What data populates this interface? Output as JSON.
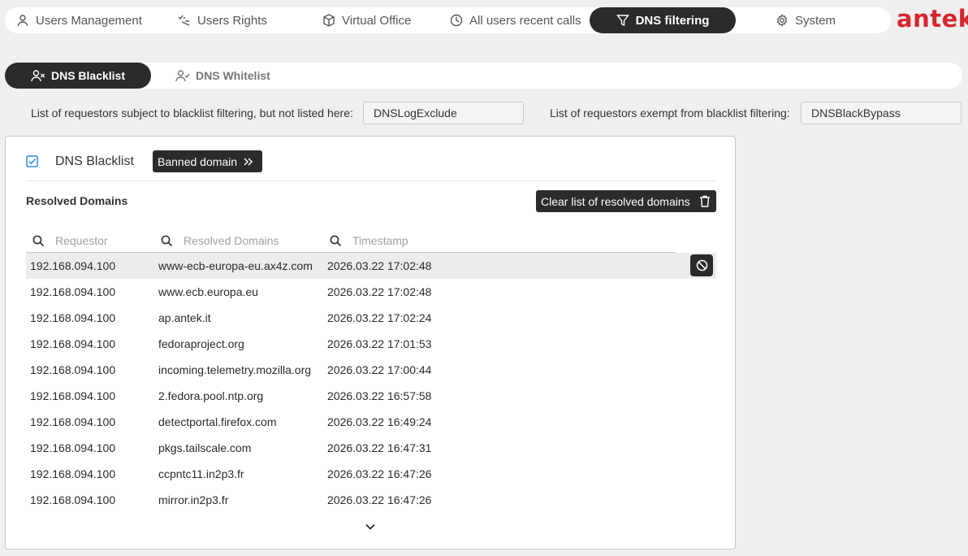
{
  "nav": {
    "tabs": [
      {
        "label": "Users Management",
        "icon": "user-icon"
      },
      {
        "label": "Users Rights",
        "icon": "check-list-icon"
      },
      {
        "label": "Virtual Office",
        "icon": "cube-icon"
      },
      {
        "label": "All users recent calls",
        "icon": "clock-icon"
      },
      {
        "label": "DNS filtering",
        "icon": "filter-icon",
        "active": true
      },
      {
        "label": "System",
        "icon": "gear-icon"
      }
    ],
    "logo": "antek"
  },
  "subnav": {
    "tabs": [
      {
        "label": "DNS Blacklist",
        "icon": "user-x-icon",
        "active": true
      },
      {
        "label": "DNS Whitelist",
        "icon": "user-check-icon"
      }
    ]
  },
  "requestors": {
    "blacklist_label": "List of requestors subject to blacklist filtering, but not listed here:",
    "blacklist_value": "DNSLogExclude",
    "bypass_label": "List of requestors exempt from blacklist filtering:",
    "bypass_value": "DNSBlackBypass"
  },
  "panel": {
    "title": "DNS Blacklist",
    "banned_button": "Banned domain",
    "section_title": "Resolved Domains",
    "clear_button": "Clear list of resolved domains",
    "columns": {
      "requestor": "Requestor",
      "domains": "Resolved Domains",
      "timestamp": "Timestamp"
    },
    "rows": [
      {
        "requestor": "192.168.094.100",
        "domain": "www-ecb-europa-eu.ax4z.com",
        "timestamp": "2026.03.22 17:02:48"
      },
      {
        "requestor": "192.168.094.100",
        "domain": "www.ecb.europa.eu",
        "timestamp": "2026.03.22 17:02:48"
      },
      {
        "requestor": "192.168.094.100",
        "domain": "ap.antek.it",
        "timestamp": "2026.03.22 17:02:24"
      },
      {
        "requestor": "192.168.094.100",
        "domain": "fedoraproject.org",
        "timestamp": "2026.03.22 17:01:53"
      },
      {
        "requestor": "192.168.094.100",
        "domain": "incoming.telemetry.mozilla.org",
        "timestamp": "2026.03.22 17:00:44"
      },
      {
        "requestor": "192.168.094.100",
        "domain": "2.fedora.pool.ntp.org",
        "timestamp": "2026.03.22 16:57:58"
      },
      {
        "requestor": "192.168.094.100",
        "domain": "detectportal.firefox.com",
        "timestamp": "2026.03.22 16:49:24"
      },
      {
        "requestor": "192.168.094.100",
        "domain": "pkgs.tailscale.com",
        "timestamp": "2026.03.22 16:47:31"
      },
      {
        "requestor": "192.168.094.100",
        "domain": "ccpntc11.in2p3.fr",
        "timestamp": "2026.03.22 16:47:26"
      },
      {
        "requestor": "192.168.094.100",
        "domain": "mirror.in2p3.fr",
        "timestamp": "2026.03.22 16:47:26"
      }
    ]
  },
  "colors": {
    "accent_dark": "#2b2b2b",
    "brand_red": "#d6262d",
    "checkbox_blue": "#2a8fd8",
    "background": "#efeff0"
  }
}
